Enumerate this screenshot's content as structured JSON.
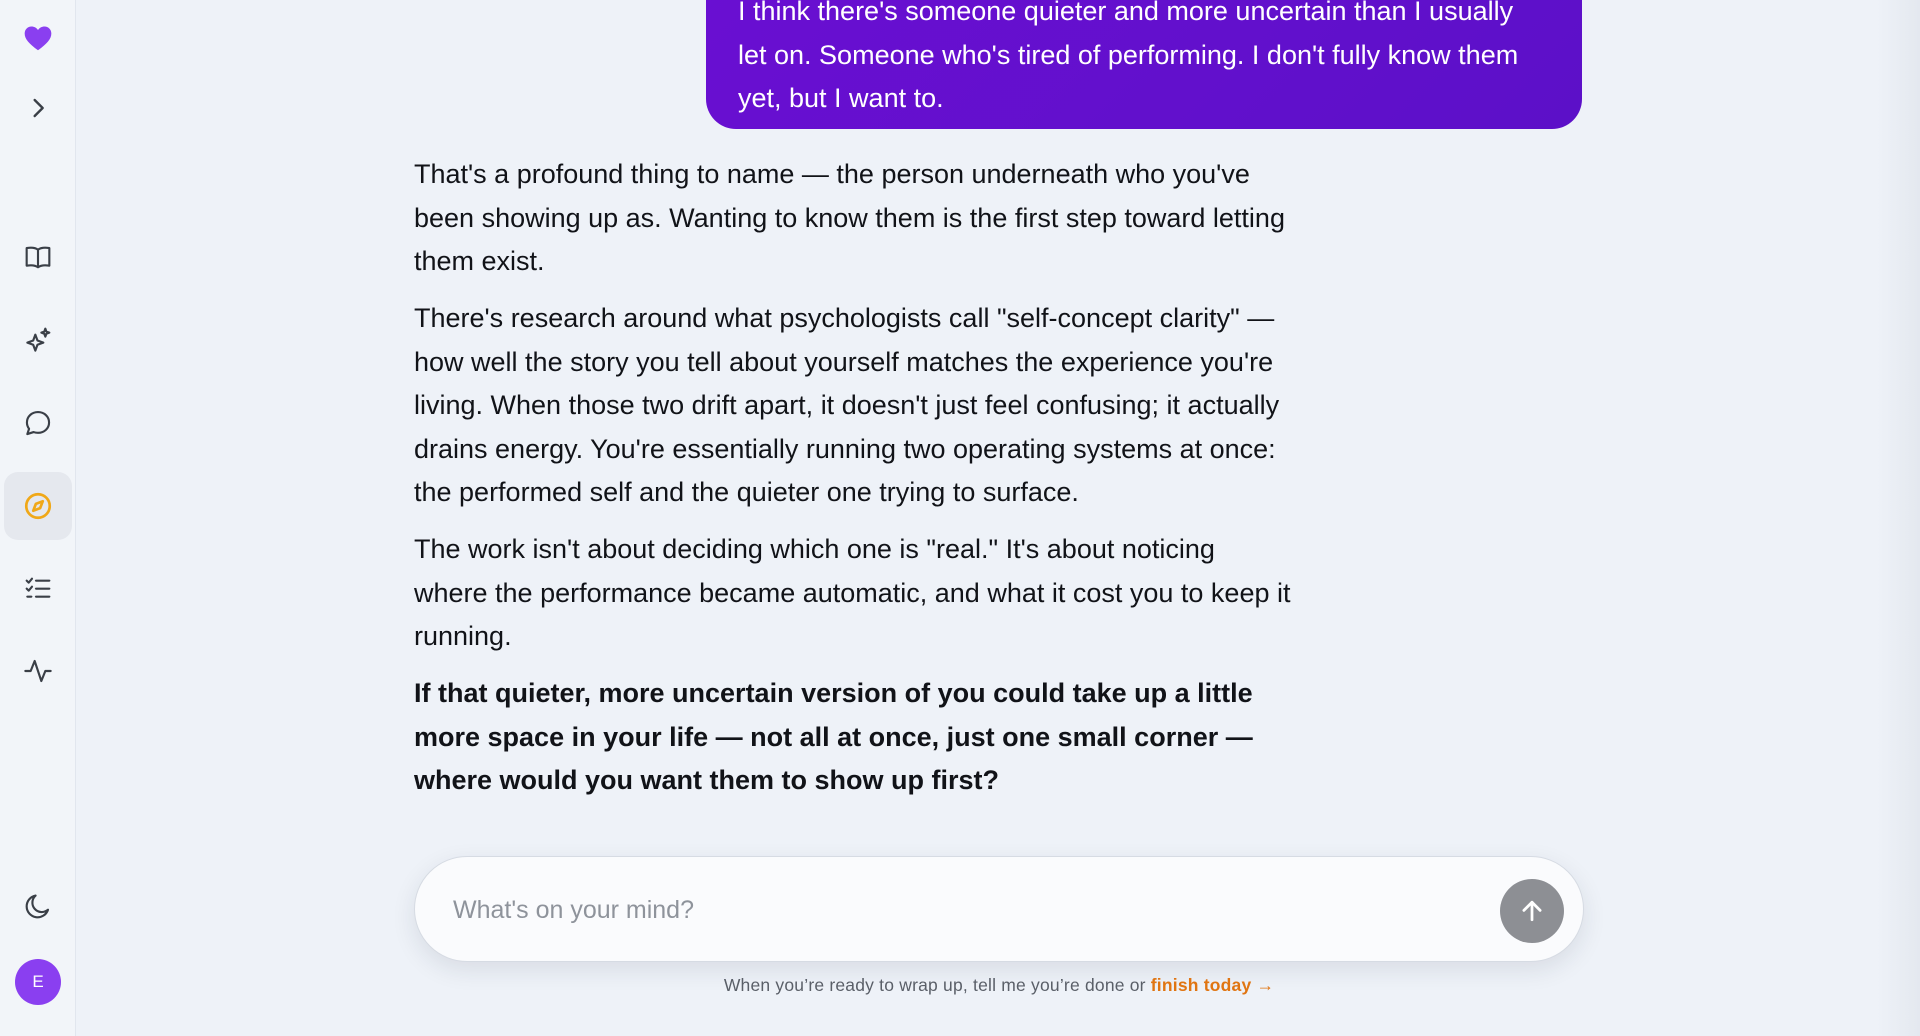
{
  "sidebar": {
    "logo_icon": "heart-icon",
    "expand_icon": "chevron-right-icon",
    "items": [
      {
        "icon": "book-icon"
      },
      {
        "icon": "sparkles-icon"
      },
      {
        "icon": "chat-bubble-icon"
      },
      {
        "icon": "compass-icon",
        "active": true
      },
      {
        "icon": "checklist-icon"
      },
      {
        "icon": "activity-icon"
      }
    ],
    "theme_icon": "moon-icon",
    "avatar_initial": "E"
  },
  "colors": {
    "accent_purple": "#6a0fd2",
    "logo_purple": "#8a3ff0",
    "active_orange": "#f0a818",
    "finish_orange": "#e07512"
  },
  "conversation": {
    "user_message": {
      "line1": "I think there's someone quieter and more uncertain than I usually",
      "line2": "let on. Someone who's tired of performing. I don't fully know them",
      "line3": "yet, but I want to."
    },
    "assistant_message": {
      "p1": "That's a profound thing to name — the person underneath who you've been showing up as. Wanting to know them is the first step toward letting them exist.",
      "p2": "There's research around what psychologists call \"self-concept clarity\" — how well the story you tell about yourself matches the experience you're living. When those two drift apart, it doesn't just feel confusing; it actually drains energy. You're essentially running two operating systems at once: the performed self and the quieter one trying to surface.",
      "p3": "The work isn't about deciding which one is \"real.\" It's about noticing where the performance became automatic, and what it cost you to keep it running.",
      "p4": "If that quieter, more uncertain version of you could take up a little more space in your life — not all at once, just one small corner — where would you want them to show up first?"
    }
  },
  "composer": {
    "placeholder": "What's on your mind?",
    "value": "",
    "send_icon": "arrow-up-icon"
  },
  "footer": {
    "note": "When you’re ready to wrap up, tell me you’re done or ",
    "finish_link": "finish today →"
  }
}
